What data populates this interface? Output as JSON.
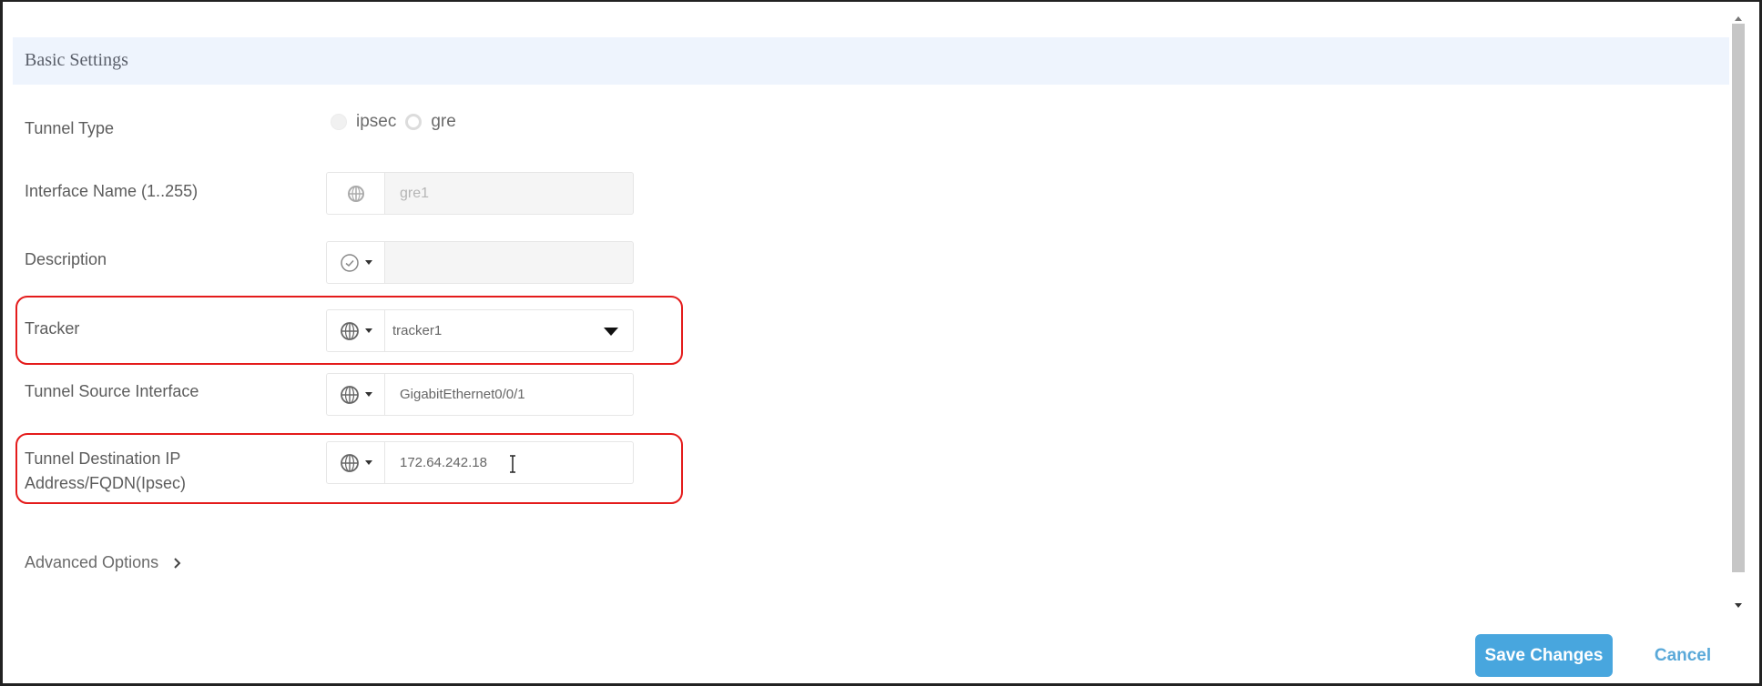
{
  "section": {
    "title": "Basic Settings"
  },
  "fields": {
    "tunnel_type": {
      "label": "Tunnel Type",
      "options": [
        {
          "label": "ipsec",
          "state": "disabled"
        },
        {
          "label": "gre",
          "state": "enabled"
        }
      ]
    },
    "interface_name": {
      "label": "Interface Name (1..255)",
      "value": "gre1",
      "scope_icon": "globe-icon",
      "disabled": true
    },
    "description": {
      "label": "Description",
      "value": "",
      "scope_icon": "check-circle-icon",
      "disabled": true
    },
    "tracker": {
      "label": "Tracker",
      "value": "tracker1",
      "scope_icon": "globe-icon",
      "highlighted": true
    },
    "tunnel_source": {
      "label": "Tunnel Source Interface",
      "value": "GigabitEthernet0/0/1",
      "scope_icon": "globe-icon"
    },
    "tunnel_destination": {
      "label_line1": "Tunnel Destination IP",
      "label_line2": "Address/FQDN(Ipsec)",
      "value": "172.64.242.18",
      "scope_icon": "globe-icon",
      "highlighted": true
    }
  },
  "advanced": {
    "label": "Advanced Options"
  },
  "actions": {
    "save_label": "Save Changes",
    "cancel_label": "Cancel"
  },
  "colors": {
    "accent": "#48a6de",
    "highlight": "#e41b1b",
    "header_bg": "#eef4fd"
  }
}
